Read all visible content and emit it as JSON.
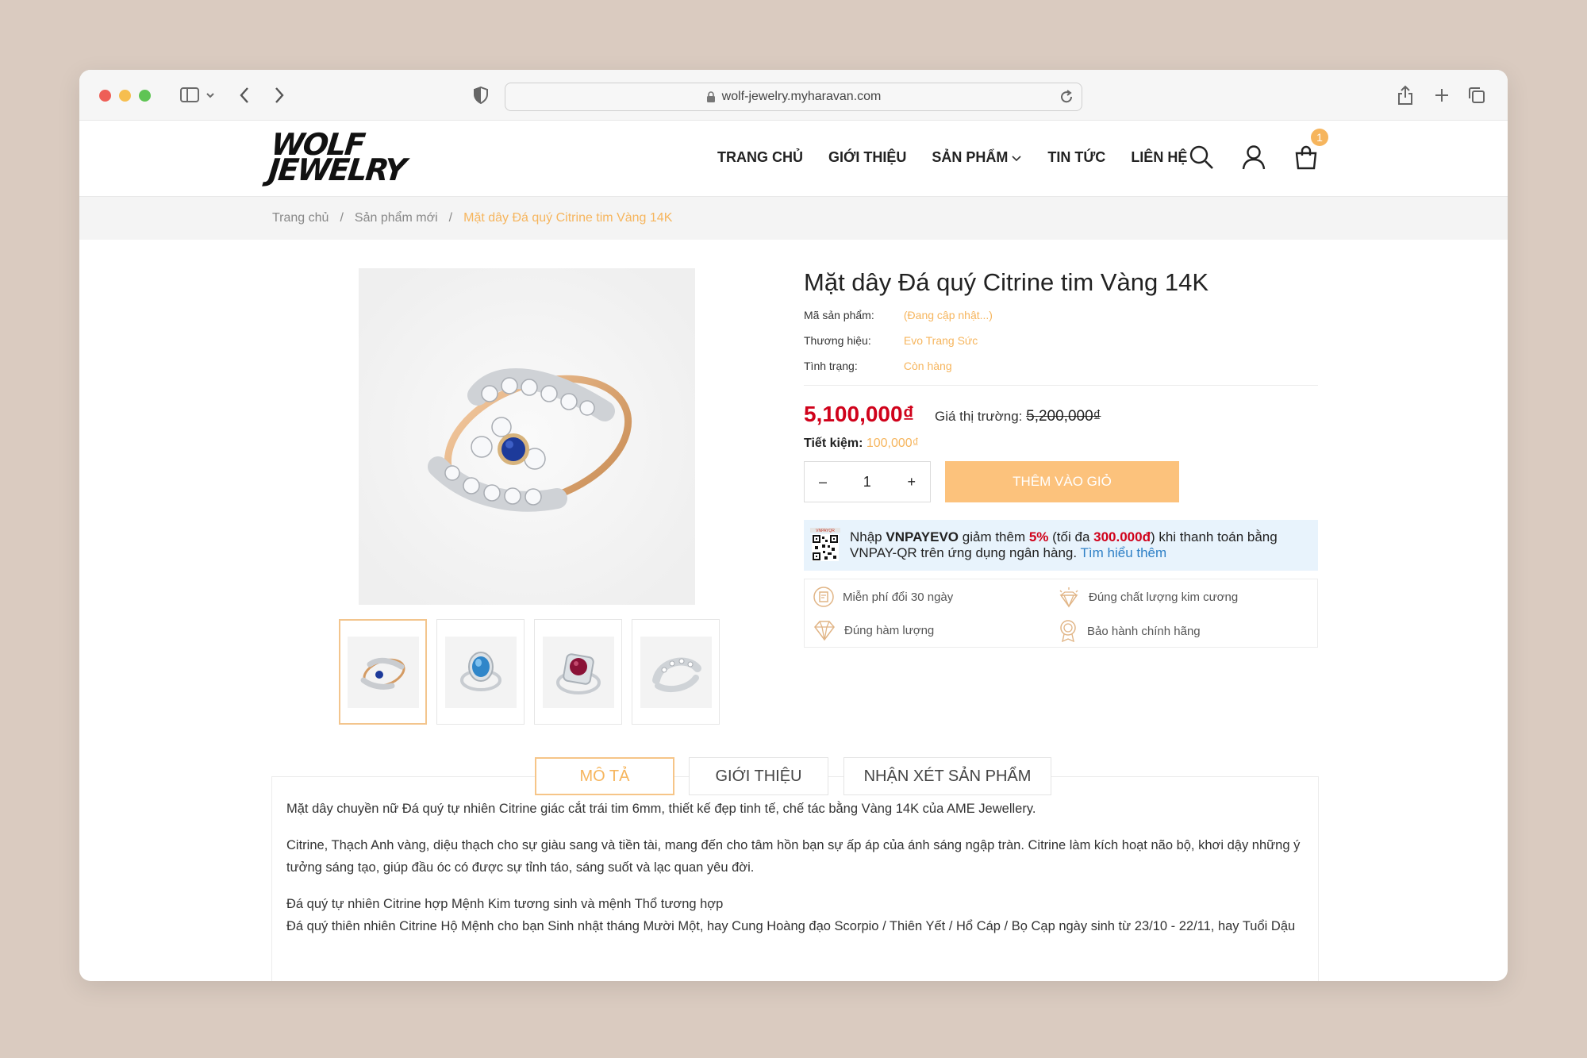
{
  "browser": {
    "url": "wolf-jewelry.myharavan.com"
  },
  "header": {
    "logo_line1": "WOLF",
    "logo_line2": "JEWELRY",
    "nav": [
      {
        "label": "TRANG CHỦ"
      },
      {
        "label": "GIỚI THIỆU"
      },
      {
        "label": "SẢN PHẨM"
      },
      {
        "label": "TIN TỨC"
      },
      {
        "label": "LIÊN HỆ"
      }
    ],
    "cart_count": "1",
    "accent": "#f6b55d"
  },
  "breadcrumb": {
    "home": "Trang chủ",
    "category": "Sản phẩm mới",
    "current": "Mặt dây Đá quý Citrine tim Vàng 14K",
    "separator": "/"
  },
  "product": {
    "title": "Mặt dây Đá quý Citrine tim Vàng 14K",
    "sku_label": "Mã sản phẩm:",
    "sku_value": "(Đang cập nhật...)",
    "brand_label": "Thương hiệu:",
    "brand_value": "Evo Trang Sức",
    "status_label": "Tình trạng:",
    "status_value": "Còn hàng",
    "price": "5,100,000₫",
    "market_label": "Giá thị trường:",
    "market_price": "5,200,000₫",
    "savings_label": "Tiết kiệm:",
    "savings_value": "100,000₫",
    "quantity": "1",
    "minus": "–",
    "plus": "+",
    "add_to_cart": "THÊM VÀO GIỎ",
    "price_color": "#d0021b"
  },
  "promo": {
    "text1": "Nhập ",
    "code": "VNPAYEVO",
    "text2": " giảm thêm ",
    "percent": "5%",
    "text3": " (tối đa ",
    "max": "300.000đ",
    "text4": ") khi thanh toán bằng VNPAY-QR trên ứng dụng ngân hàng. ",
    "link": "Tìm hiểu thêm"
  },
  "features": [
    {
      "label": "Miễn phí đổi 30 ngày",
      "icon": "exchange-icon"
    },
    {
      "label": "Đúng chất lượng kim cương",
      "icon": "diamond-quality-icon"
    },
    {
      "label": "Đúng hàm lượng",
      "icon": "diamond-icon"
    },
    {
      "label": "Bảo hành chính hãng",
      "icon": "warranty-icon"
    }
  ],
  "tabs": [
    {
      "label": "MÔ TẢ"
    },
    {
      "label": "GIỚI THIỆU"
    },
    {
      "label": "NHẬN XÉT SẢN PHẨM"
    }
  ],
  "description": {
    "p1": "Mặt dây chuyền nữ Đá quý tự nhiên Citrine giác cắt trái tim 6mm, thiết kế đẹp tinh tế, chế tác bằng Vàng 14K của AME Jewellery.",
    "p2": "Citrine, Thạch Anh vàng, diệu thạch cho sự giàu sang và tiền tài, mang đến cho tâm hồn bạn sự ấp áp của ánh sáng ngập tràn. Citrine làm kích hoạt não bộ, khơi dậy những ý tưởng sáng tạo, giúp đầu óc có được sự tỉnh táo, sáng suốt và lạc quan yêu đời.",
    "p3": "Đá quý tự nhiên Citrine hợp Mệnh Kim tương sinh và mệnh Thổ tương hợp",
    "p4": "Đá quý thiên nhiên Citrine Hộ Mệnh cho bạn Sinh nhật tháng Mười Một, hay Cung Hoàng đạo Scorpio / Thiên Yết / Hổ Cáp / Bọ Cạp ngày sinh từ 23/10 - 22/11, hay Tuổi Dậu"
  }
}
